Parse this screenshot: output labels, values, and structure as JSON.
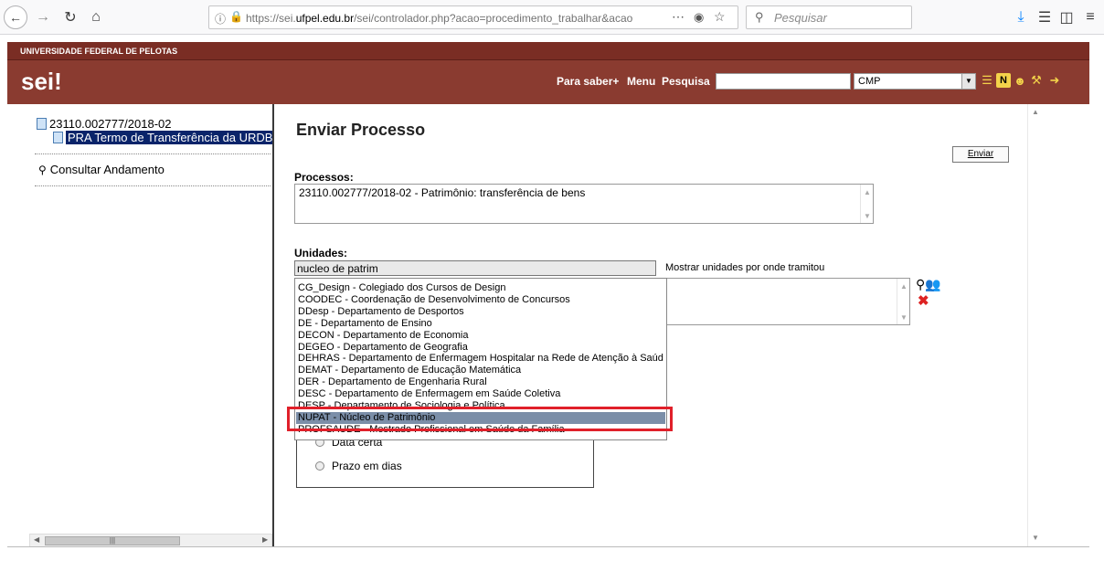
{
  "browser": {
    "url_prefix": "https://sei.",
    "url_domain": "ufpel.edu.br",
    "url_rest": "/sei/controlador.php?acao=procedimento_trabalhar&acao",
    "search_placeholder": "Pesquisar"
  },
  "header": {
    "university": "UNIVERSIDADE FEDERAL DE PELOTAS",
    "logo": "sei!",
    "links": [
      "Para saber+",
      "Menu",
      "Pesquisa"
    ],
    "unit_selected": "CMP",
    "icon_names": [
      "list-icon",
      "notes-icon",
      "user-icon",
      "tools-icon",
      "exit-icon"
    ]
  },
  "tree": {
    "process": "23110.002777/2018-02",
    "document": "PRA Termo de Transferência da URDB (",
    "consultar": "Consultar Andamento"
  },
  "main": {
    "title": "Enviar Processo",
    "enviar_button": "Enviar",
    "processos_label": "Processos:",
    "processos_value": "23110.002777/2018-02 - Patrimônio: transferência de bens",
    "unidades_label": "Unidades:",
    "unidades_input": "nucleo de patrim",
    "mostrar_label": "Mostrar unidades por onde tramitou"
  },
  "dropdown": {
    "items": [
      "CG_Design - Colegiado dos Cursos de Design",
      "COODEC - Coordenação de Desenvolvimento de Concursos",
      "DDesp - Departamento de Desportos",
      "DE - Departamento de Ensino",
      "DECON - Departamento de Economia",
      "DEGEO - Departamento de Geografia",
      "DEHRAS - Departamento de Enfermagem Hospitalar na Rede de Atenção à Saúde",
      "DEMAT - Departamento de Educação Matemática",
      "DER - Departamento de Engenharia Rural",
      "DESC - Departamento de Enfermagem em Saúde Coletiva",
      "DESP - Departamento de Sociologia e Política",
      "NUPAT - Núcleo de Patrimônio",
      "PROFSAUDE - Mestrado Profissional em Saúde da Família"
    ],
    "selected_index": 11
  },
  "prazo": {
    "options": [
      "Data certa",
      "Prazo em dias"
    ]
  },
  "colors": {
    "header_bg": "#8a3b30",
    "strip_bg": "#7a2d24",
    "highlight": "#e0202a",
    "selection": "#0a246a"
  }
}
